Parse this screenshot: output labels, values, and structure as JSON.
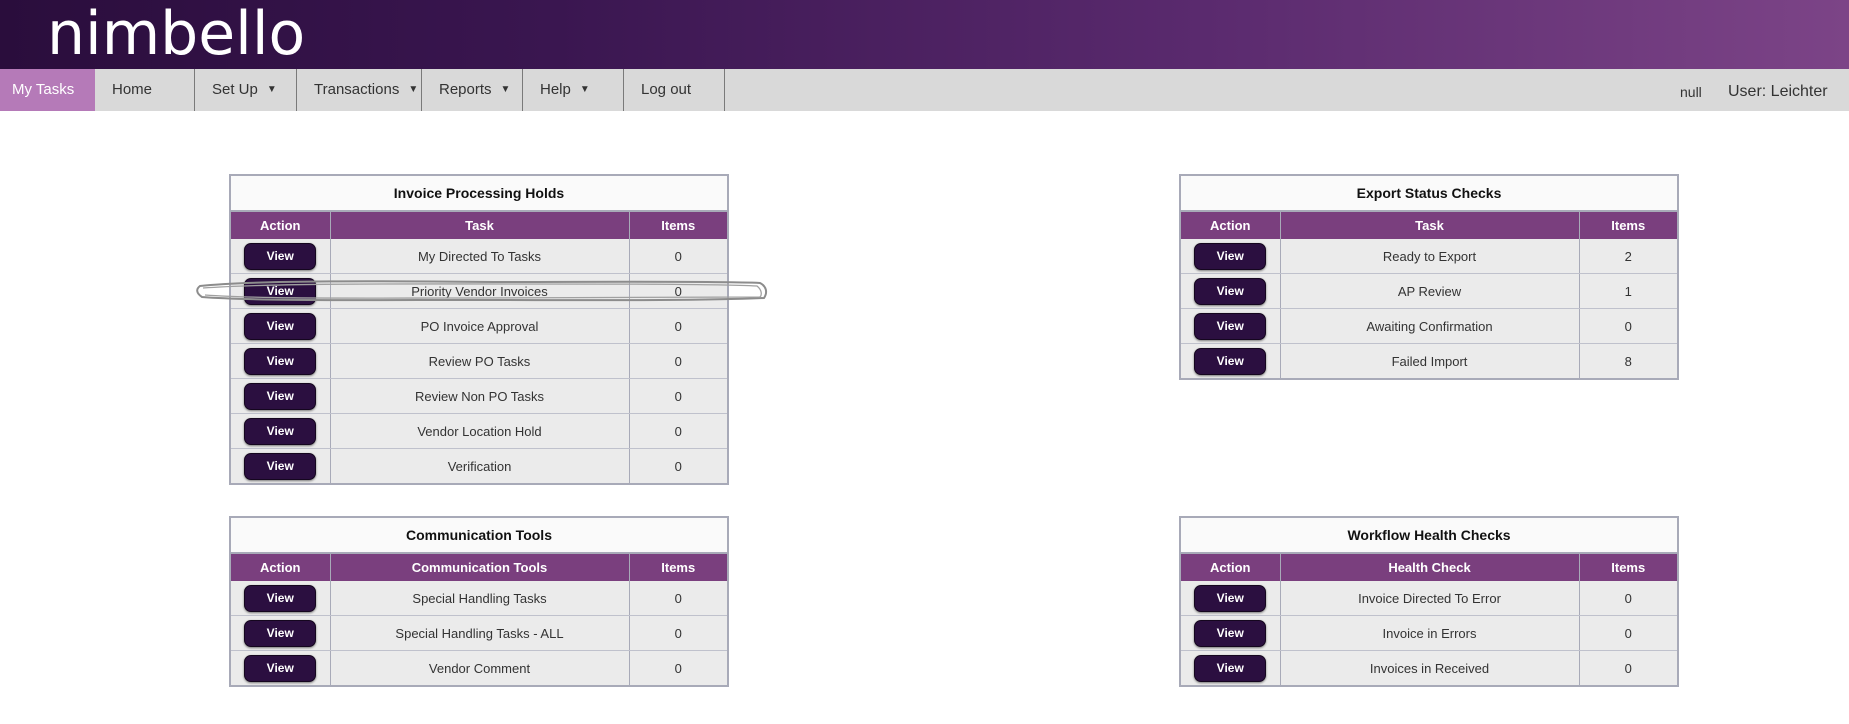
{
  "brand": {
    "logo_text": "nimbello",
    "banner_colors": [
      "#2a0d3c",
      "#7c4487"
    ]
  },
  "nav": {
    "items": [
      {
        "label": "My Tasks",
        "active": true,
        "has_dropdown": false
      },
      {
        "label": "Home",
        "active": false,
        "has_dropdown": false
      },
      {
        "label": "Set Up",
        "active": false,
        "has_dropdown": true
      },
      {
        "label": "Transactions",
        "active": false,
        "has_dropdown": true
      },
      {
        "label": "Reports",
        "active": false,
        "has_dropdown": true
      },
      {
        "label": "Help",
        "active": false,
        "has_dropdown": true
      },
      {
        "label": "Log out",
        "active": false,
        "has_dropdown": false
      }
    ],
    "caret_glyph": "▼",
    "status_text": "null",
    "user_text": "User: Leichter"
  },
  "colors": {
    "accent": "#7a3f7e",
    "active_tab": "#b57ab8",
    "button": "#2b0f40"
  },
  "panels": {
    "invoice_holds": {
      "title": "Invoice Processing Holds",
      "headers": [
        "Action",
        "Task",
        "Items"
      ],
      "rows": [
        {
          "button": "View",
          "task": "My Directed To Tasks",
          "items": "0"
        },
        {
          "button": "View",
          "task": "Priority Vendor Invoices",
          "items": "0"
        },
        {
          "button": "View",
          "task": "PO Invoice Approval",
          "items": "0"
        },
        {
          "button": "View",
          "task": "Review PO Tasks",
          "items": "0"
        },
        {
          "button": "View",
          "task": "Review Non PO Tasks",
          "items": "0"
        },
        {
          "button": "View",
          "task": "Vendor Location Hold",
          "items": "0"
        },
        {
          "button": "View",
          "task": "Verification",
          "items": "0"
        }
      ]
    },
    "export_status": {
      "title": "Export Status Checks",
      "headers": [
        "Action",
        "Task",
        "Items"
      ],
      "rows": [
        {
          "button": "View",
          "task": "Ready to Export",
          "items": "2"
        },
        {
          "button": "View",
          "task": "AP Review",
          "items": "1"
        },
        {
          "button": "View",
          "task": "Awaiting Confirmation",
          "items": "0"
        },
        {
          "button": "View",
          "task": "Failed Import",
          "items": "8"
        }
      ]
    },
    "communication_tools": {
      "title": "Communication Tools",
      "headers": [
        "Action",
        "Communication Tools",
        "Items"
      ],
      "rows": [
        {
          "button": "View",
          "task": "Special Handling Tasks",
          "items": "0"
        },
        {
          "button": "View",
          "task": "Special Handling Tasks - ALL",
          "items": "0"
        },
        {
          "button": "View",
          "task": "Vendor Comment",
          "items": "0"
        }
      ]
    },
    "workflow_health": {
      "title": "Workflow Health Checks",
      "headers": [
        "Action",
        "Health Check",
        "Items"
      ],
      "rows": [
        {
          "button": "View",
          "task": "Invoice Directed To Error",
          "items": "0"
        },
        {
          "button": "View",
          "task": "Invoice in Errors",
          "items": "0"
        },
        {
          "button": "View",
          "task": "Invoices in Received",
          "items": "0"
        }
      ]
    }
  }
}
